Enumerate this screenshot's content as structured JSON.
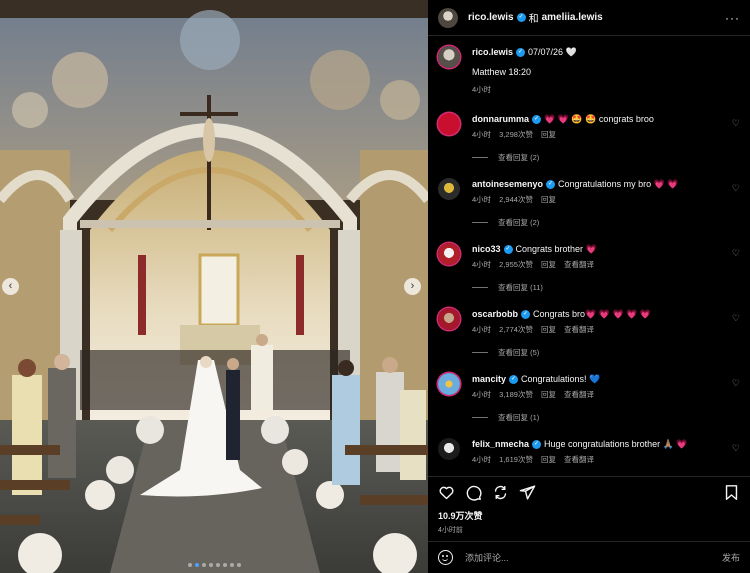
{
  "header": {
    "user1": "rico.lewis",
    "and_text": "和",
    "user2": "ameliia.lewis",
    "more": "···"
  },
  "caption": {
    "user": "rico.lewis",
    "date": "07/07/26",
    "heart": "🤍",
    "text": "Matthew 18:20",
    "time": "4小时"
  },
  "comments": [
    {
      "user": "donnarumma",
      "text": "💗 💗 🤩 🤩 congrats broo",
      "time": "4小时",
      "likes": "3,298次赞",
      "reply": "回复",
      "translate": "",
      "view_replies": "查看回复 (2)"
    },
    {
      "user": "antoinesemenyo",
      "text": "Congratulations my bro 💗 💗",
      "time": "4小时",
      "likes": "2,944次赞",
      "reply": "回复",
      "translate": "",
      "view_replies": "查看回复 (2)"
    },
    {
      "user": "nico33",
      "text": "Congrats brother 💗",
      "time": "4小时",
      "likes": "2,955次赞",
      "reply": "回复",
      "translate": "查看翻译",
      "view_replies": "查看回复 (11)"
    },
    {
      "user": "oscarbobb",
      "text": "Congrats bro💗 💗 💗 💗 💗",
      "time": "4小时",
      "likes": "2,774次赞",
      "reply": "回复",
      "translate": "查看翻译",
      "view_replies": "查看回复 (5)"
    },
    {
      "user": "mancity",
      "text": "Congratulations! 💙",
      "time": "4小时",
      "likes": "3,189次赞",
      "reply": "回复",
      "translate": "查看翻译",
      "view_replies": "查看回复 (1)"
    },
    {
      "user": "felix_nmecha",
      "text": "Huge congratulations brother 🙏🏽 💗",
      "time": "4小时",
      "likes": "1,619次赞",
      "reply": "回复",
      "translate": "查看翻译",
      "view_replies": ""
    }
  ],
  "actions": {
    "likes": "10.9万次赞",
    "time": "4小时前"
  },
  "add_comment": {
    "placeholder": "添加评论...",
    "post": "发布"
  },
  "carousel": {
    "prev": "‹",
    "next": "›",
    "slide_count": 8,
    "active_slide": 1
  },
  "colors": {
    "verified": "#1d9bf0",
    "secondary_text": "#a8a8a8",
    "background": "#000000"
  }
}
